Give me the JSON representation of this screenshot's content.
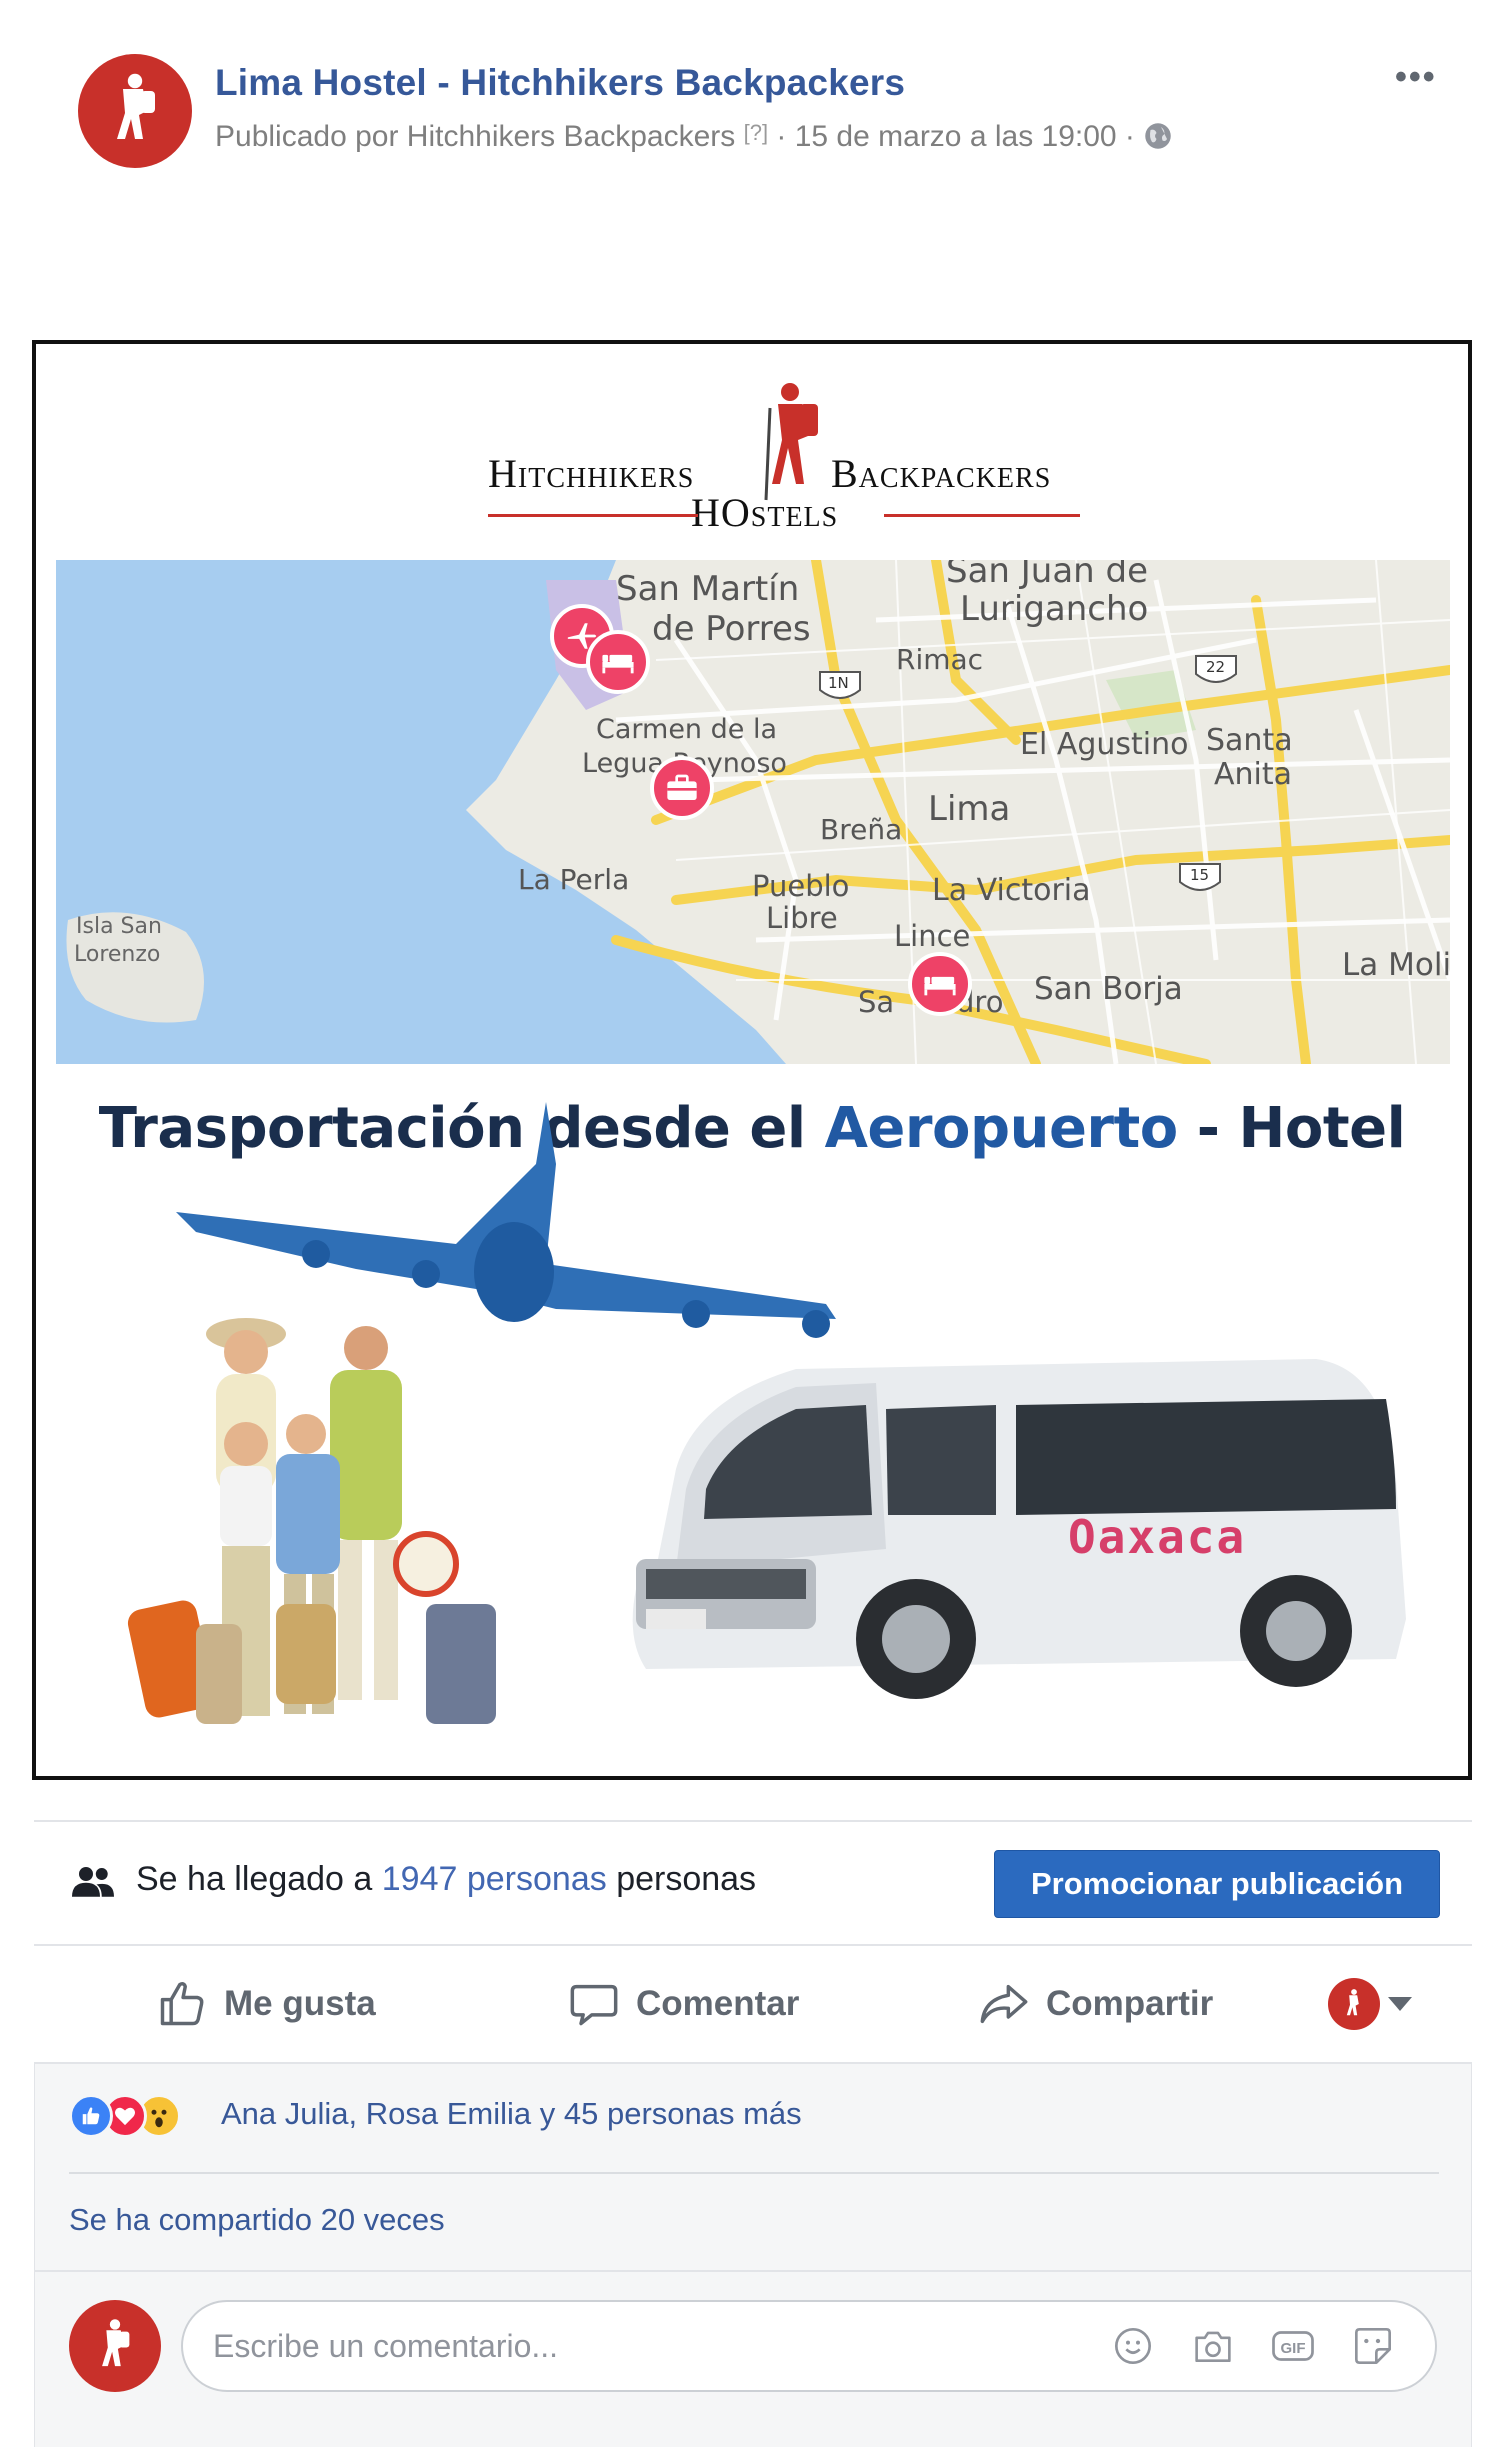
{
  "header": {
    "page_name": "Lima Hostel - Hitchhikers Backpackers",
    "published_by": "Publicado por Hitchhikers Backpackers",
    "info_marker": "[?]",
    "date_text": "· 15 de marzo a las 19:00 ·",
    "more_label": "•••"
  },
  "post_image": {
    "logo_left": "Hitchhikers",
    "logo_right": "Backpackers",
    "logo_sub": "HOstels",
    "map_labels": {
      "smp1": "San Martín",
      "smp2": "de Porres",
      "sjl1": "San Juan de",
      "sjl2": "Lurigancho",
      "rimac": "Rimac",
      "carmen1": "Carmen de la",
      "carmen2": "Legua Reynoso",
      "agustino": "El Agustino",
      "santa1": "Santa",
      "santa2": "Anita",
      "lima": "Lima",
      "brena": "Breña",
      "perla": "La Perla",
      "pueblo1": "Pueblo",
      "pueblo2": "Libre",
      "victoria": "La Victoria",
      "isla1": "Isla San",
      "isla2": "Lorenzo",
      "lince": "Lince",
      "sanisidro_a": "Sa",
      "sanisidro_b": "dro",
      "borja": "San Borja",
      "molina": "La Moli",
      "shield_1n": "1N",
      "shield_22": "22",
      "shield_15": "15"
    },
    "headline_part1": "Trasportación desde el ",
    "headline_part2": "Aeropuerto",
    "headline_part3": " - Hotel",
    "van_brand": "Oaxaca"
  },
  "reach": {
    "prefix": "Se ha llegado a ",
    "count": "1947",
    "link_word": "personas",
    "suffix": "personas",
    "promote_label": "Promocionar publicación"
  },
  "actions": {
    "like": "Me gusta",
    "comment": "Comentar",
    "share": "Compartir"
  },
  "reactions": {
    "text": "Ana Julia, Rosa Emilia y 45 personas más",
    "shares_text": "Se ha compartido 20 veces"
  },
  "comment": {
    "placeholder": "Escribe un comentario..."
  },
  "colors": {
    "brand_red": "#c8302a",
    "fb_blue": "#4267b2",
    "pin_pink": "#ee4267",
    "sea": "#a7cdf0"
  }
}
